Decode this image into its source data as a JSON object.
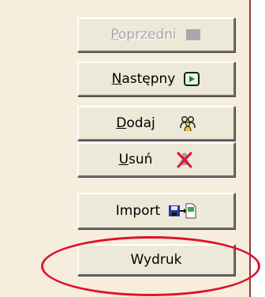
{
  "buttons": {
    "poprzedni": {
      "mnemonic": "P",
      "rest": "oprzedni",
      "icon": "square-icon",
      "enabled": false
    },
    "nastepny": {
      "mnemonic": "N",
      "rest": "astępny",
      "icon": "play-icon",
      "enabled": true
    },
    "dodaj": {
      "mnemonic": "D",
      "rest": "odaj",
      "icon": "users-icon",
      "enabled": true
    },
    "usun": {
      "mnemonic": "U",
      "rest": "suń",
      "icon": "delete-user-icon",
      "enabled": true
    },
    "import": {
      "label": "Import",
      "icon": "import-icon",
      "enabled": true
    },
    "wydruk": {
      "label": "Wydruk",
      "enabled": true
    }
  },
  "colors": {
    "background": "#f6eddc",
    "button_face": "#ece9d8",
    "highlight_oval": "#e0112c",
    "accent_line": "#8f3838"
  }
}
